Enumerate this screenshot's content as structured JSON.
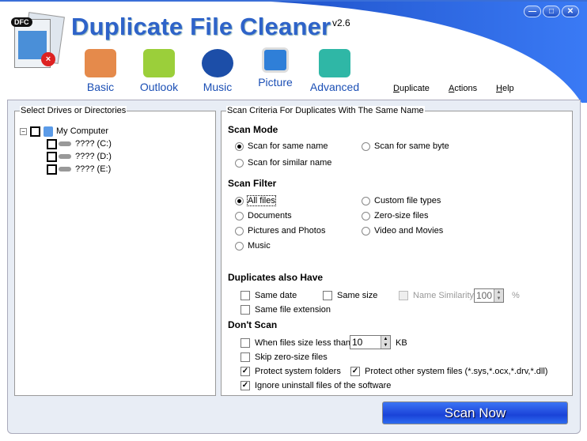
{
  "app": {
    "title": "Duplicate File Cleaner",
    "version": "v2.6",
    "logo_text": "DFC"
  },
  "window_buttons": {
    "minimize": "—",
    "maximize": "□",
    "close": "✕"
  },
  "toolbar": [
    {
      "label": "Basic",
      "icon": "computer-icon",
      "color": "#e58a4b"
    },
    {
      "label": "Outlook",
      "icon": "mail-icon",
      "color": "#9bcf3a"
    },
    {
      "label": "Music",
      "icon": "headphones-icon",
      "color": "#1c4ea8"
    },
    {
      "label": "Picture",
      "icon": "picture-icon",
      "color": "#2f7fd8"
    },
    {
      "label": "Advanced",
      "icon": "advanced-icon",
      "color": "#2fb7a6"
    }
  ],
  "menu": [
    {
      "key": "D",
      "rest": "uplicate"
    },
    {
      "key": "A",
      "rest": "ctions"
    },
    {
      "key": "H",
      "rest": "elp"
    }
  ],
  "left": {
    "caption": "Select Drives or Directories",
    "root": "My Computer",
    "drives": [
      "???? (C:)",
      "???? (D:)",
      "???? (E:)"
    ]
  },
  "right": {
    "caption": "Scan Criteria For Duplicates With The Same Name",
    "scan_mode": {
      "title": "Scan Mode",
      "options": [
        "Scan for same name",
        "Scan for same byte",
        "Scan for similar name"
      ]
    },
    "scan_filter": {
      "title": "Scan Filter",
      "options": [
        "All files",
        "Custom file types",
        "Documents",
        "Zero-size files",
        "Pictures and Photos",
        "Video and Movies",
        "Music"
      ]
    },
    "dup": {
      "title": "Duplicates also Have",
      "same_date": "Same date",
      "same_size": "Same size",
      "name_sim": "Name Similarity",
      "name_sim_value": "100",
      "percent": "%",
      "same_ext": "Same file extension"
    },
    "dont": {
      "title": "Don't Scan",
      "less_than": "When files size less than",
      "size_value": "10",
      "unit": "KB",
      "skip_zero": "Skip zero-size files",
      "protect_folders": "Protect system folders",
      "protect_files": "Protect other system files (*.sys,*.ocx,*.drv,*.dll)",
      "ignore_uninstall": "Ignore uninstall files of the software"
    }
  },
  "scan_button": "Scan Now"
}
